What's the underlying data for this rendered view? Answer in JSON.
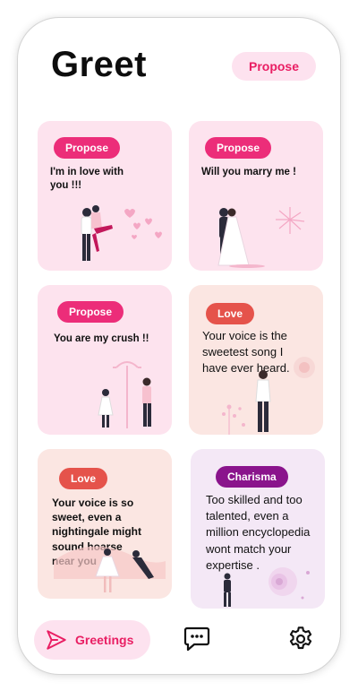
{
  "app": {
    "title": "Greet"
  },
  "filter": {
    "label": "Propose"
  },
  "cards": [
    {
      "tag": "Propose",
      "message": "I'm in love with you !!!"
    },
    {
      "tag": "Propose",
      "message": "Will you marry me !"
    },
    {
      "tag": "Propose",
      "message": "You are my crush !!"
    },
    {
      "tag": "Love",
      "message": "Your voice is the sweetest song I have ever heard."
    },
    {
      "tag": "Love",
      "message": "Your voice is so sweet, even a nightingale might sound hoarse near you"
    },
    {
      "tag": "Charisma",
      "message": "Too skilled and too talented, even a million encyclopedia wont match your expertise ."
    }
  ],
  "nav": {
    "greetings_label": "Greetings",
    "items": [
      "send-icon",
      "chat-icon",
      "gear-icon"
    ]
  },
  "colors": {
    "accent": "#e91e63",
    "propose": "#ec2d79",
    "love": "#e5534b",
    "charisma": "#8a148c"
  }
}
